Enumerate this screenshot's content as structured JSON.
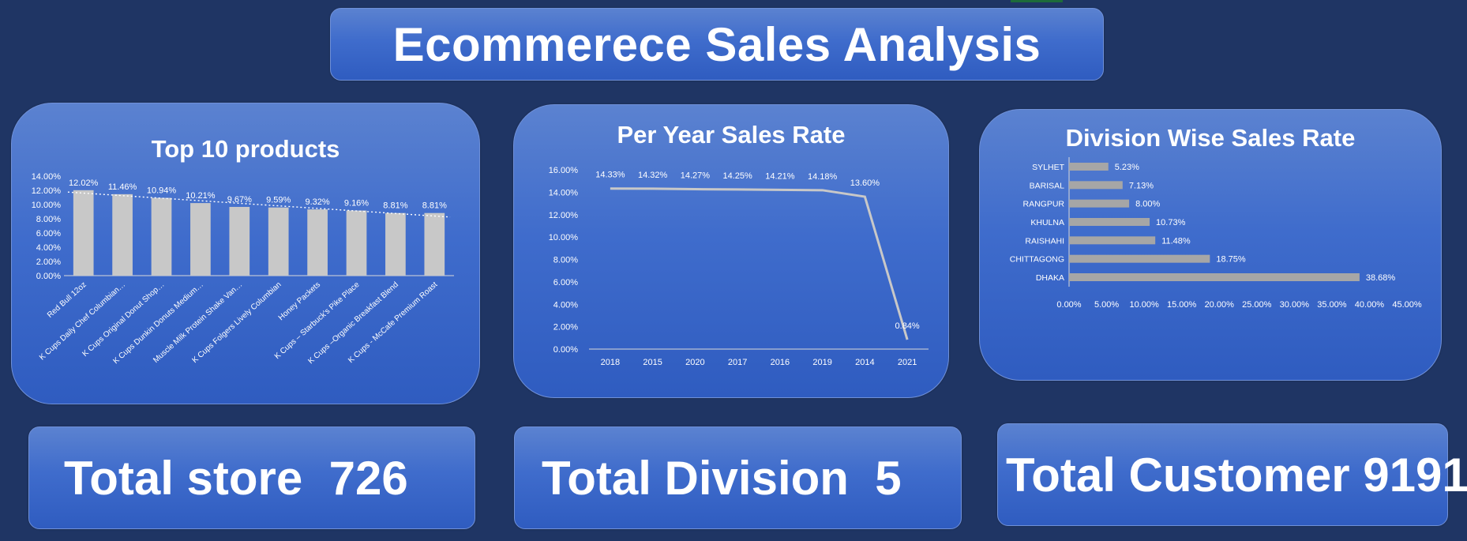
{
  "dashboard": {
    "title": "Ecommerece Sales Analysis",
    "kpis": [
      {
        "label": "Total store  726"
      },
      {
        "label": "Total Division  5"
      },
      {
        "label": "Total Customer 9191"
      }
    ]
  },
  "chart_data": [
    {
      "type": "bar",
      "title": "Top 10 products",
      "categories": [
        "Red Bull 12oz",
        "K Cups Daily Chef Columbian…",
        "K Cups Original Donut Shop…",
        "K Cups Dunkin Donuts Medium…",
        "Muscle Milk Protein Shake Van…",
        "K Cups Folgers Lively Columbian",
        "Honey Packets",
        "K Cups – Starbuck's Pike Place",
        "K Cups –Organic Breakfast Blend",
        "K Cups - McCafe Premium Roast"
      ],
      "values": [
        12.02,
        11.46,
        10.94,
        10.21,
        9.67,
        9.59,
        9.32,
        9.16,
        8.81,
        8.81
      ],
      "data_labels": [
        "12.02%",
        "11.46%",
        "10.94%",
        "10.21%",
        "9.67%",
        "9.59%",
        "9.32%",
        "9.16%",
        "8.81%",
        "8.81%"
      ],
      "y_ticks": [
        "0.00%",
        "2.00%",
        "4.00%",
        "6.00%",
        "8.00%",
        "10.00%",
        "12.00%",
        "14.00%"
      ],
      "ylim": [
        0,
        14
      ],
      "trendline": true,
      "bar_color": "#c8c8c8"
    },
    {
      "type": "line",
      "title": "Per Year Sales Rate",
      "categories": [
        "2018",
        "2015",
        "2020",
        "2017",
        "2016",
        "2019",
        "2014",
        "2021"
      ],
      "values": [
        14.33,
        14.32,
        14.27,
        14.25,
        14.21,
        14.18,
        13.6,
        0.84
      ],
      "data_labels": [
        "14.33%",
        "14.32%",
        "14.27%",
        "14.25%",
        "14.21%",
        "14.18%",
        "13.60%",
        "0.84%"
      ],
      "y_ticks": [
        "0.00%",
        "2.00%",
        "4.00%",
        "6.00%",
        "8.00%",
        "10.00%",
        "12.00%",
        "14.00%",
        "16.00%"
      ],
      "ylim": [
        0,
        16
      ],
      "line_color": "#c8c8c8"
    },
    {
      "type": "bar",
      "orientation": "horizontal",
      "title": "Division Wise Sales Rate",
      "categories": [
        "SYLHET",
        "BARISAL",
        "RANGPUR",
        "KHULNA",
        "RAISHAHI",
        "CHITTAGONG",
        "DHAKA"
      ],
      "values": [
        5.23,
        7.13,
        8.0,
        10.73,
        11.48,
        18.75,
        38.68
      ],
      "data_labels": [
        "5.23%",
        "7.13%",
        "8.00%",
        "10.73%",
        "11.48%",
        "18.75%",
        "38.68%"
      ],
      "x_ticks": [
        "0.00%",
        "5.00%",
        "10.00%",
        "15.00%",
        "20.00%",
        "25.00%",
        "30.00%",
        "35.00%",
        "40.00%",
        "45.00%"
      ],
      "xlim": [
        0,
        45
      ],
      "bar_color": "#a6a6a6"
    }
  ]
}
